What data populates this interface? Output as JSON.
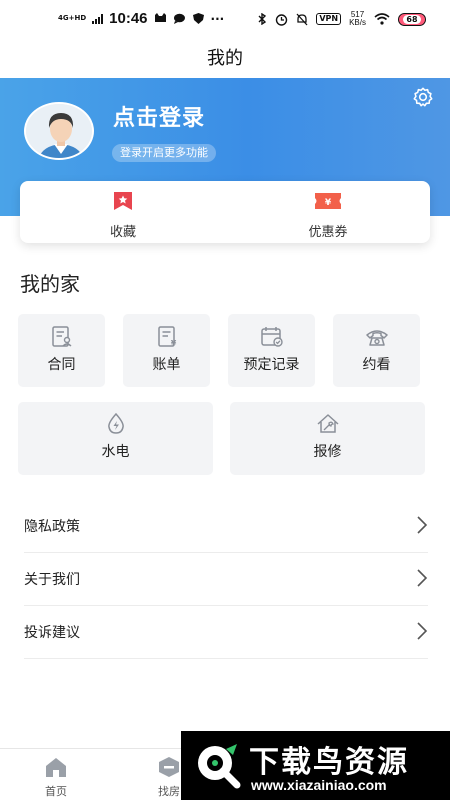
{
  "status_bar": {
    "network": "4G+HD",
    "time": "10:46",
    "vpn": "VPN",
    "speed_value": "517",
    "speed_unit": "KB/s",
    "battery": "68"
  },
  "page_title": "我的",
  "profile": {
    "login_title": "点击登录",
    "login_subtitle": "登录开启更多功能",
    "settings_icon": "gear-icon",
    "avatar_icon": "default-avatar"
  },
  "quick_actions": {
    "favorites": {
      "label": "收藏",
      "icon": "bookmark-icon",
      "color": "#e8454f"
    },
    "coupons": {
      "label": "优惠券",
      "icon": "ticket-icon",
      "color": "#f2604a"
    }
  },
  "my_home": {
    "title": "我的家",
    "tiles": [
      {
        "label": "合同",
        "icon": "contract-icon"
      },
      {
        "label": "账单",
        "icon": "bill-icon"
      },
      {
        "label": "预定记录",
        "icon": "calendar-check-icon"
      },
      {
        "label": "约看",
        "icon": "telephone-icon"
      },
      {
        "label": "水电",
        "icon": "water-electric-icon"
      },
      {
        "label": "报修",
        "icon": "repair-house-icon"
      }
    ]
  },
  "settings_list": [
    {
      "label": "隐私政策"
    },
    {
      "label": "关于我们"
    },
    {
      "label": "投诉建议"
    }
  ],
  "bottom_nav": [
    {
      "label": "首页",
      "icon": "home-icon"
    },
    {
      "label": "找房",
      "icon": "find-house-icon"
    }
  ],
  "watermark": {
    "brand": "下载鸟资源",
    "url": "www.xiazainiao.com"
  },
  "colors": {
    "banner": "#3b8ee6",
    "tile_bg": "#f3f4f6",
    "icon_gray": "#8a8f98"
  }
}
